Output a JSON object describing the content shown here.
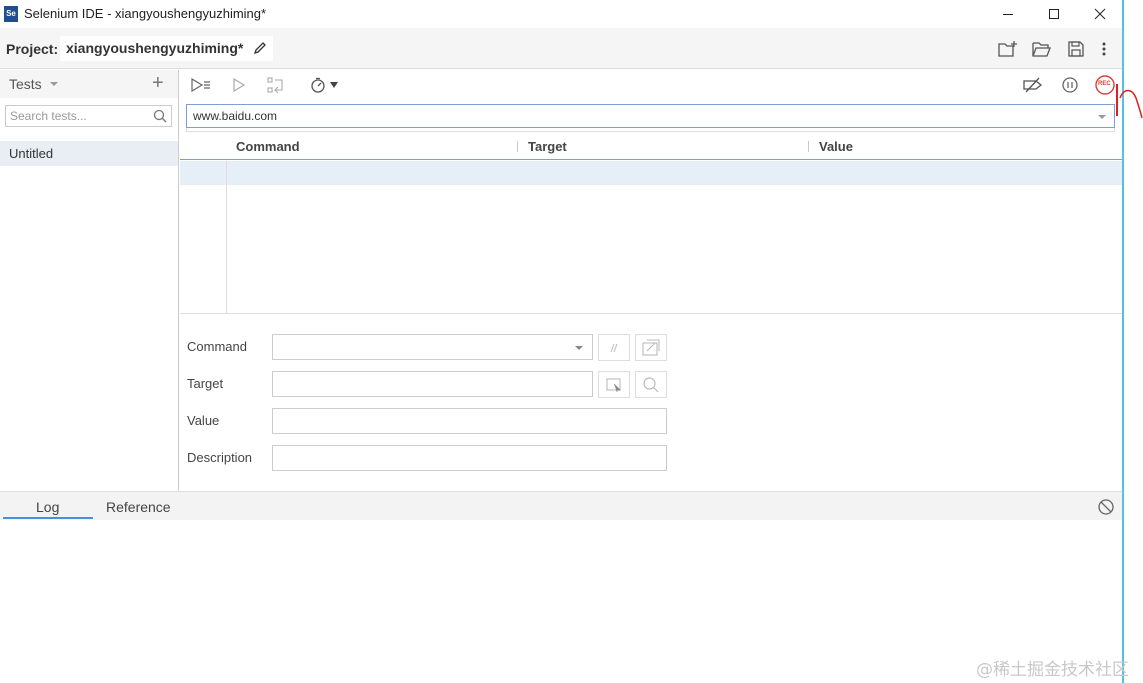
{
  "window": {
    "title": "Selenium IDE - xiangyoushengyuzhiming*",
    "logo": "Se",
    "controls": [
      "minimize-icon",
      "maximize-icon",
      "close-icon"
    ]
  },
  "project": {
    "label": "Project:",
    "name": "xiangyoushengyuzhiming*",
    "actions": [
      "new-project-icon",
      "open-project-icon",
      "save-project-icon",
      "more-menu-icon"
    ]
  },
  "sidebar": {
    "title": "Tests",
    "search_placeholder": "Search tests...",
    "tests": [
      {
        "label": "Untitled",
        "selected": true
      }
    ]
  },
  "toolbar": {
    "left_icons": [
      "run-all-tests-icon",
      "run-current-test-icon",
      "step-over-icon",
      "test-speed-icon"
    ],
    "right_icons": [
      "disable-breakpoints-icon",
      "pause-on-exceptions-icon",
      "record-icon"
    ],
    "record_label": "REC"
  },
  "url": {
    "value": "www.baidu.com"
  },
  "table": {
    "columns": [
      "Command",
      "Target",
      "Value"
    ]
  },
  "editor": {
    "command_label": "Command",
    "target_label": "Target",
    "value_label": "Value",
    "description_label": "Description",
    "command_value": "",
    "target_value": "",
    "value_value": "",
    "description_value": ""
  },
  "bottom": {
    "tabs": [
      "Log",
      "Reference"
    ],
    "active_tab": "Log"
  },
  "watermark": "@稀土掘金技术社区",
  "colors": {
    "accent": "#4a90d9",
    "selection": "#e6eff7",
    "record": "#d9403a",
    "edge": "#53c1df"
  }
}
